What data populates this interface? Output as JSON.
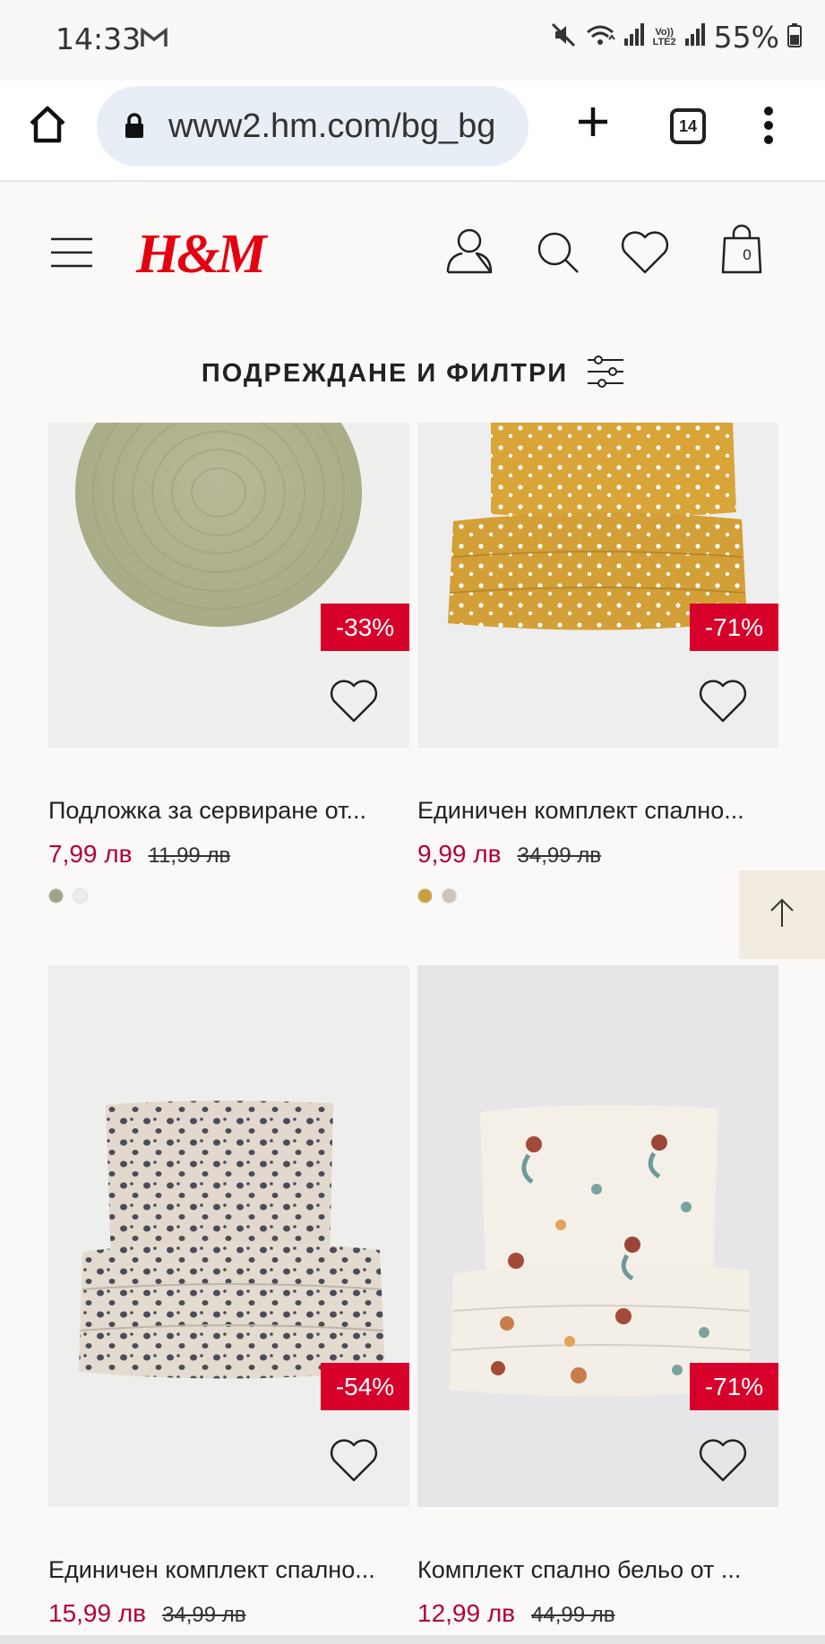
{
  "status_bar": {
    "time": "14:33",
    "volte": "Vo))",
    "lte": "LTE2",
    "battery": "55%"
  },
  "browser": {
    "url": "www2.hm.com/bg_bg",
    "tab_count": "14"
  },
  "header": {
    "logo": "H&M",
    "bag_count": "0",
    "brand_color": "#e50010"
  },
  "sort_filter": {
    "label": "ПОДРЕЖДАНЕ И ФИЛТРИ"
  },
  "products": [
    {
      "title": "Подложка за сервиране от...",
      "price": "7,99 лв",
      "old_price": "11,99 лв",
      "discount": "-33%",
      "swatches": [
        "#9ba38b",
        "#ececec"
      ]
    },
    {
      "title": "Единичен комплект спално...",
      "price": "9,99 лв",
      "old_price": "34,99 лв",
      "discount": "-71%",
      "swatches": [
        "#c9a13d",
        "#cfc4ba"
      ]
    },
    {
      "title": "Единичен комплект спално...",
      "price": "15,99 лв",
      "old_price": "34,99 лв",
      "discount": "-54%",
      "swatches": []
    },
    {
      "title": "Комплект спално бельо от ...",
      "price": "12,99 лв",
      "old_price": "44,99 лв",
      "discount": "-71%",
      "swatches": []
    }
  ],
  "colors": {
    "sale_badge": "#d6002a",
    "sale_price": "#b0003a"
  }
}
